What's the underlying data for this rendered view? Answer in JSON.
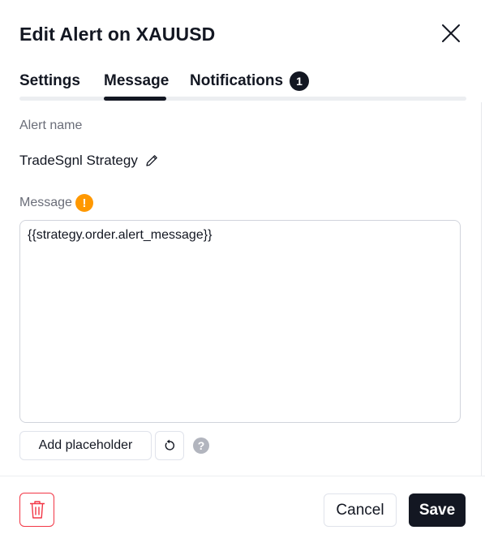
{
  "dialog": {
    "title": "Edit Alert on XAUUSD",
    "close_icon": "close-icon"
  },
  "tabs": [
    {
      "label": "Settings",
      "active": false
    },
    {
      "label": "Message",
      "active": true
    },
    {
      "label": "Notifications",
      "active": false,
      "badge": "1"
    }
  ],
  "alert_name": {
    "label": "Alert name",
    "value": "TradeSgnl Strategy",
    "edit_icon": "pencil-icon"
  },
  "message": {
    "label": "Message",
    "warning_icon": "warning-icon",
    "value": "{{strategy.order.alert_message}}"
  },
  "toolbar": {
    "add_placeholder_label": "Add placeholder",
    "reset_icon": "reset-icon",
    "help_icon": "help-icon",
    "help_glyph": "?"
  },
  "footer": {
    "delete_icon": "trash-icon",
    "cancel_label": "Cancel",
    "save_label": "Save"
  },
  "colors": {
    "accent": "#131722",
    "warning": "#ff9800",
    "danger": "#f23645",
    "muted_text": "#6a6d78"
  }
}
